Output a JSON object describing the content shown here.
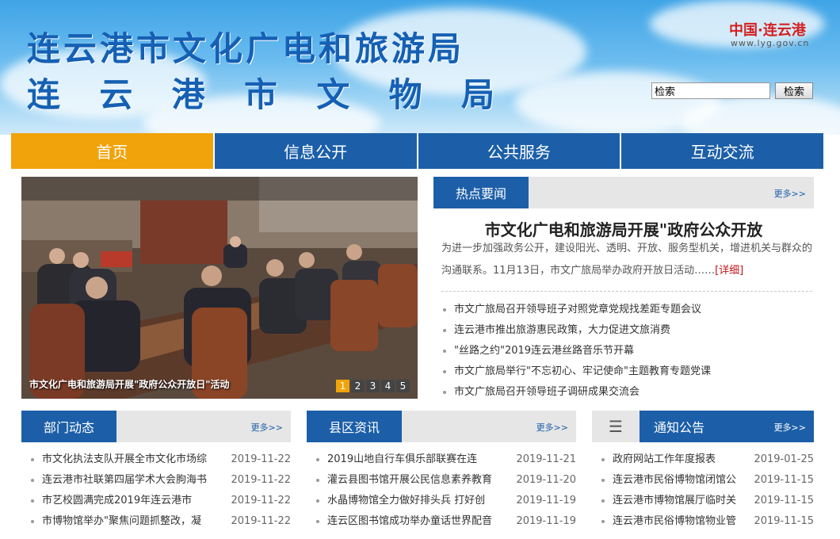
{
  "header": {
    "title_line1": "连云港市文化广电和旅游局",
    "title_line2": "连云港市文物局",
    "logo_cn": "中国·连云港",
    "logo_url": "www.lyg.gov.cn",
    "search_value": "检索",
    "search_button": "检索"
  },
  "nav": [
    {
      "label": "首页",
      "active": true
    },
    {
      "label": "信息公开"
    },
    {
      "label": "公共服务"
    },
    {
      "label": "互动交流"
    }
  ],
  "slider": {
    "caption": "市文化广电和旅游局开展\"政府公众开放日\"活动",
    "pages": [
      "1",
      "2",
      "3",
      "4",
      "5"
    ],
    "active_page": "1"
  },
  "hot": {
    "title": "热点要闻",
    "more": "更多>>",
    "headline": "市文化广电和旅游局开展\"政府公众开放",
    "summary": "为进一步加强政务公开，建设阳光、透明、开放、服务型机关，增进机关与群众的沟通联系。11月13日，市文广旅局举办政府开放日活动……",
    "detail": "[详细]",
    "items": [
      "市文广旅局召开领导班子对照党章党规找差距专题会议",
      "连云港市推出旅游惠民政策，大力促进文旅消费",
      "\"丝路之约\"2019连云港丝路音乐节开幕",
      "市文广旅局举行\"不忘初心、牢记使命\"主题教育专题党课",
      "市文广旅局召开领导班子调研成果交流会"
    ]
  },
  "dept": {
    "title": "部门动态",
    "more": "更多>>",
    "items": [
      {
        "text": "市文化执法支队开展全市文化市场综",
        "date": "2019-11-22"
      },
      {
        "text": "连云港市社联第四届学术大会朐海书",
        "date": "2019-11-22"
      },
      {
        "text": "市艺校圆满完成2019年连云港市",
        "date": "2019-11-22"
      },
      {
        "text": "市博物馆举办\"聚焦问题抓整改，凝",
        "date": "2019-11-22"
      }
    ]
  },
  "county": {
    "title": "县区资讯",
    "more": "更多>>",
    "items": [
      {
        "text": "2019山地自行车俱乐部联赛在连",
        "date": "2019-11-21"
      },
      {
        "text": "灌云县图书馆开展公民信息素养教育",
        "date": "2019-11-20"
      },
      {
        "text": "水晶博物馆全力做好排头兵 打好创",
        "date": "2019-11-19"
      },
      {
        "text": "连云区图书馆成功举办童话世界配音",
        "date": "2019-11-19"
      }
    ]
  },
  "notice": {
    "menu_glyph": "☰",
    "title": "通知公告",
    "more": "更多>>",
    "items": [
      {
        "text": "政府网站工作年度报表",
        "date": "2019-01-25"
      },
      {
        "text": "连云港市民俗博物馆闭馆公",
        "date": "2019-11-15"
      },
      {
        "text": "连云港市博物馆展厅临时关",
        "date": "2019-11-15"
      },
      {
        "text": "连云港市民俗博物馆物业管",
        "date": "2019-11-15"
      }
    ]
  },
  "colors": {
    "nav_blue": "#1c5fa8",
    "nav_active": "#f0a30a",
    "detail_red": "#c0141b",
    "title_blue": "#1560b4"
  }
}
